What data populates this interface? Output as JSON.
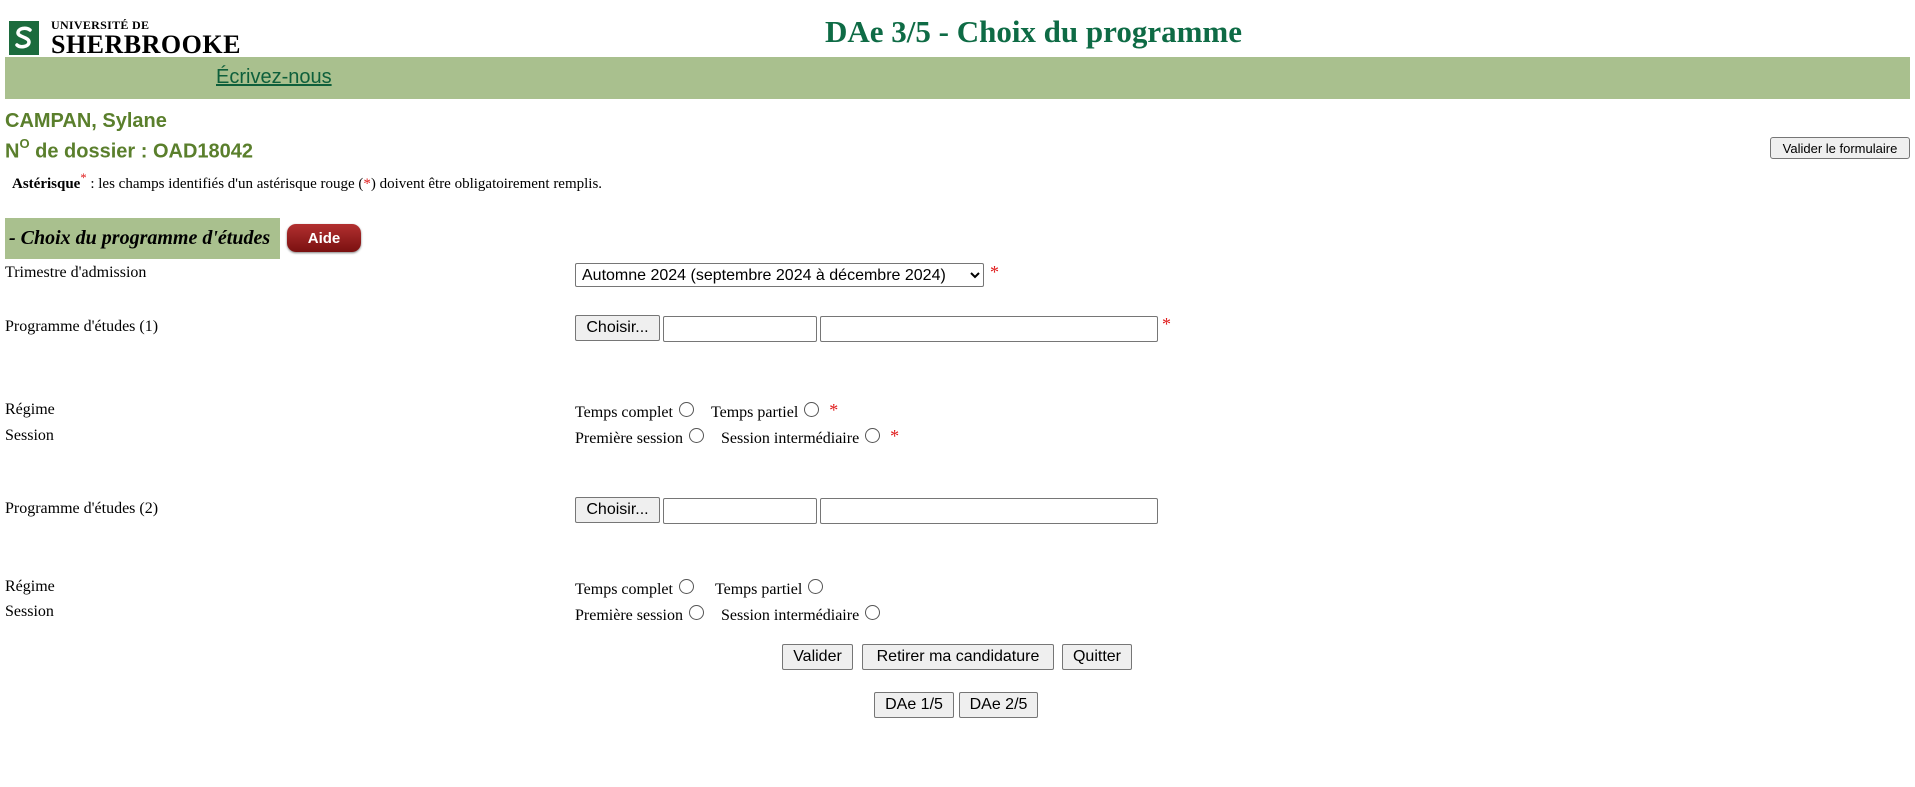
{
  "header": {
    "logo_line1": "UNIVERSITÉ DE",
    "logo_line2": "SHERBROOKE",
    "title": "DAe 3/5 - Choix du programme",
    "nav_link": "Écrivez-nous"
  },
  "applicant": {
    "name": "CAMPAN, Sylane",
    "dossier_prefix": "N",
    "dossier_sup": "O",
    "dossier_rest": " de dossier : OAD18042"
  },
  "validate_form_label": "Valider le formulaire",
  "note": {
    "bold": "Astérisque",
    "star": "*",
    "text_before": " : les champs identifiés d'un astérisque rouge (",
    "text_after": ") doivent être obligatoirement remplis."
  },
  "section": {
    "title": "- Choix du programme d'études",
    "help_label": "Aide"
  },
  "form": {
    "trimester_label": "Trimestre d'admission",
    "trimester_value": "Automne 2024 (septembre 2024 à décembre 2024)",
    "program1_label": "Programme d'études (1)",
    "program2_label": "Programme d'études (2)",
    "choose_label": "Choisir...",
    "regime_label": "Régime",
    "session_label": "Session",
    "full_time": "Temps complet",
    "part_time": "Temps partiel",
    "first_session": "Première session",
    "intermediate_session": "Session intermédiaire",
    "required_mark": "*"
  },
  "actions": {
    "validate": "Valider",
    "withdraw": "Retirer ma candidature",
    "quit": "Quitter",
    "step1": "DAe 1/5",
    "step2": "DAe 2/5"
  },
  "colors": {
    "brand_green": "#0e6b45",
    "bar_green": "#a9c08e",
    "applicant_green": "#5a7f2c",
    "required_red": "#e01b1b"
  }
}
